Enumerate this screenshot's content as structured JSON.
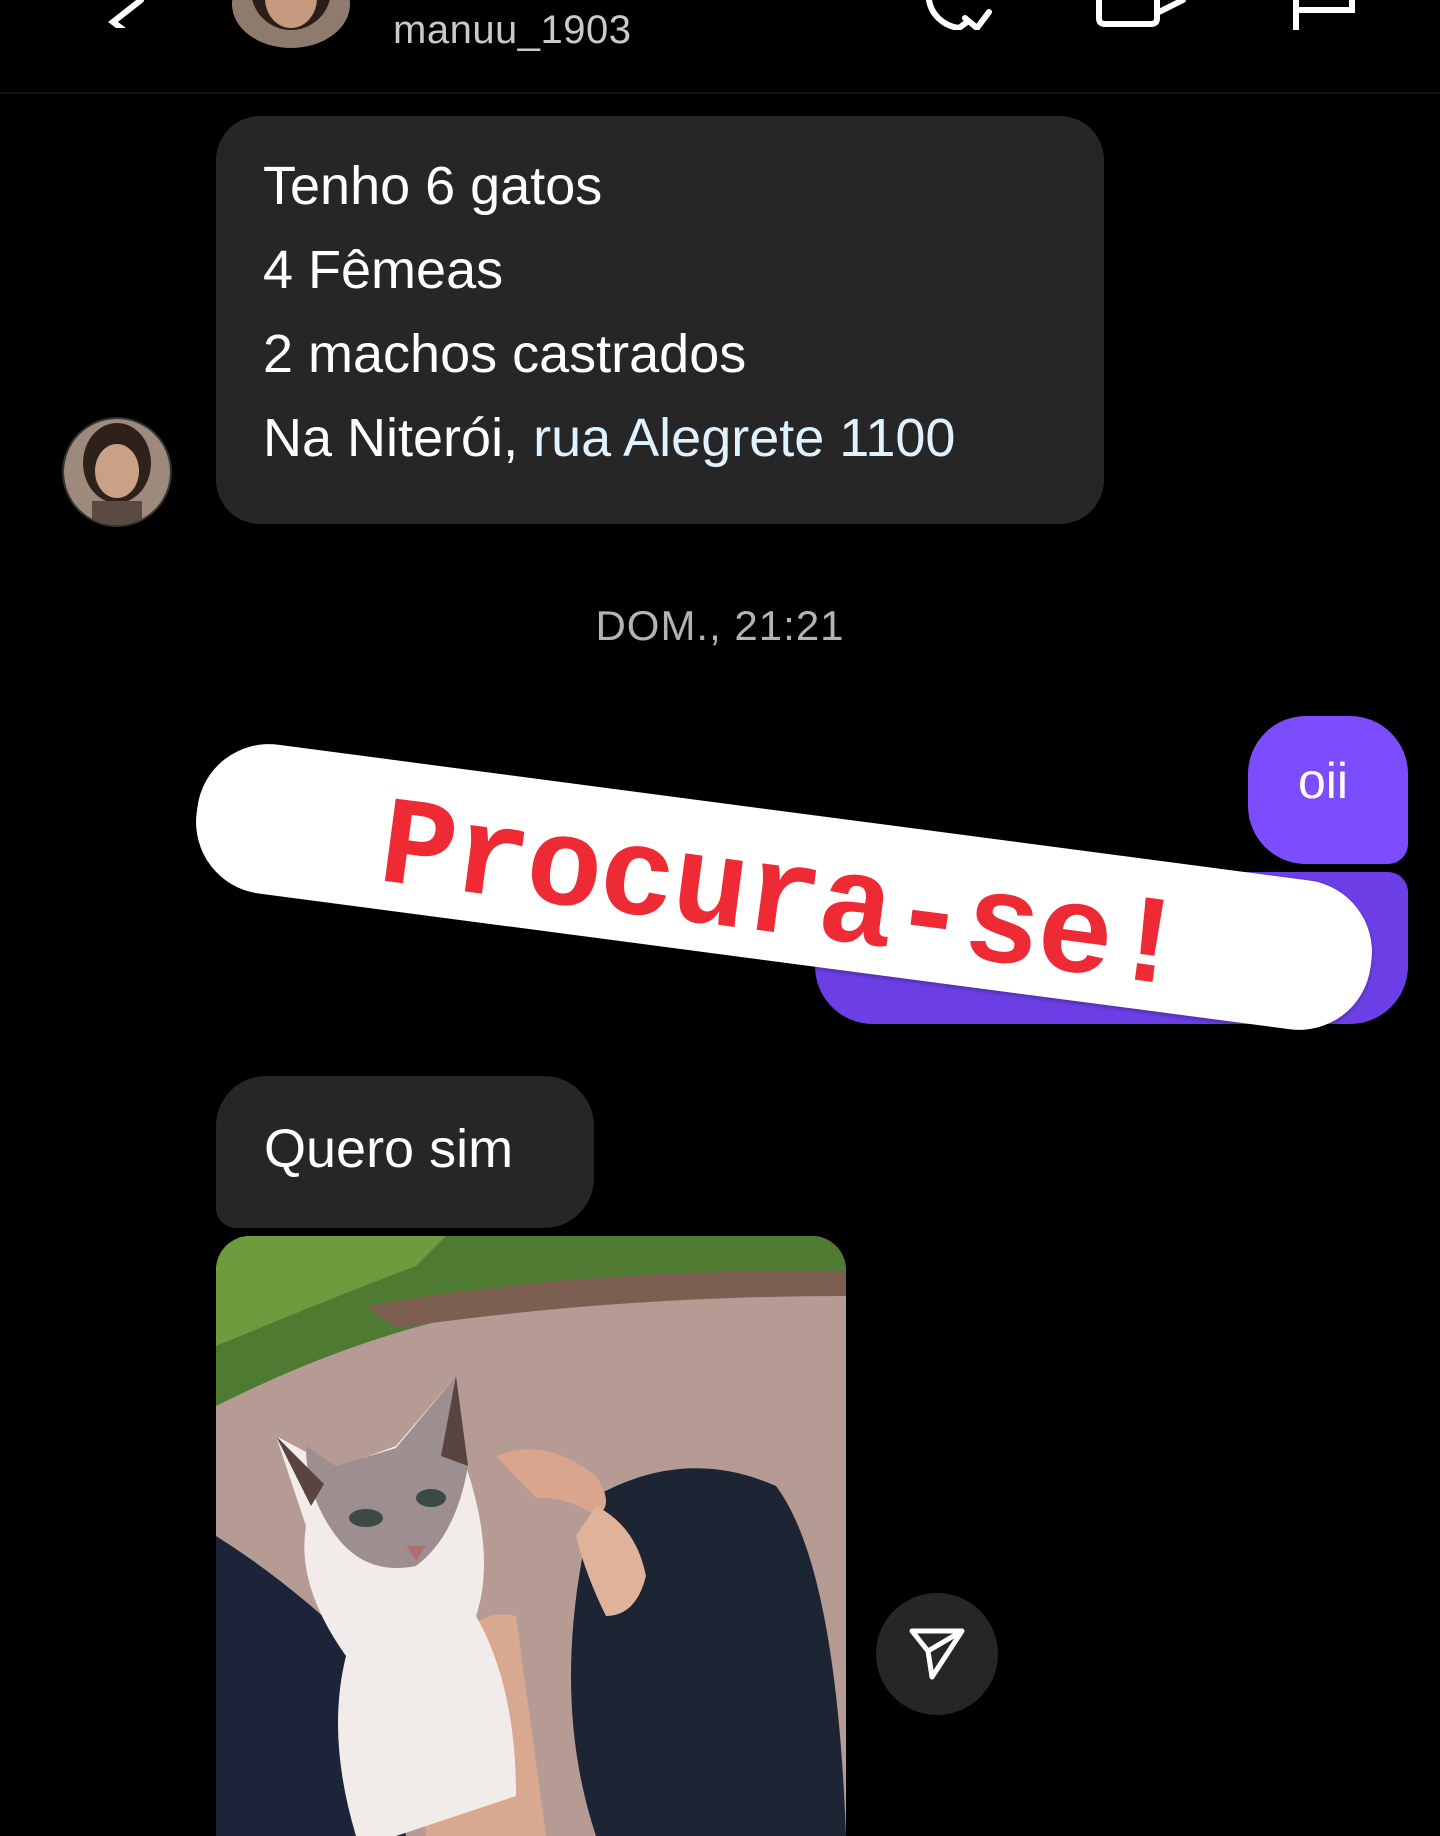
{
  "header": {
    "username": "manuu_1903",
    "icons": [
      "back-icon",
      "avatar",
      "phone-icon",
      "video-icon",
      "flag-icon"
    ]
  },
  "messages": {
    "received_1": {
      "lines": [
        "Tenho 6 gatos",
        "4 Fêmeas",
        "2 machos castrados"
      ],
      "last_line_prefix": "Na Niterói, ",
      "last_line_link": "rua Alegrete 1100"
    },
    "timestamp": "DOM., 21:21",
    "sent_1": "oii",
    "received_2": "Quero sim"
  },
  "sticker": {
    "text": "Procura-se!",
    "color": "#ee2a35"
  },
  "colors": {
    "sent_bubble": "#7c4dff",
    "received_bubble": "#262626",
    "background": "#000000"
  },
  "share_icon": "send-icon"
}
